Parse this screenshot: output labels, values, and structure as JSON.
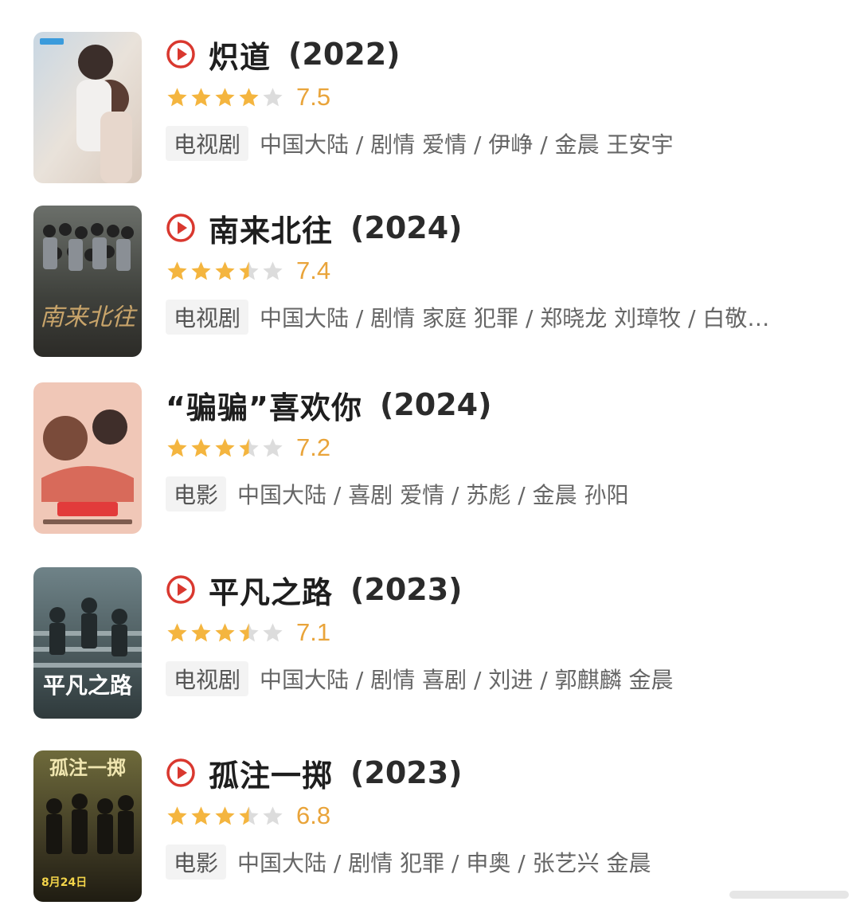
{
  "colors": {
    "play_icon": "#d9382f",
    "star_filled": "#f4b53f",
    "star_empty": "#dcdcdc",
    "score": "#e9a43a"
  },
  "items": [
    {
      "title": "炽道",
      "year": "(2022)",
      "has_play_icon": true,
      "stars": 4,
      "score": "7.5",
      "type": "电视剧",
      "meta": "中国大陆 / 剧情 爱情 / 伊峥 / 金晨 王安宇",
      "poster_icon": "poster-image"
    },
    {
      "title": "南来北往",
      "year": "(2024)",
      "has_play_icon": true,
      "stars": 3.5,
      "score": "7.4",
      "type": "电视剧",
      "meta": "中国大陆 / 剧情 家庭 犯罪 / 郑晓龙 刘璋牧 / 白敬…",
      "poster_icon": "poster-image"
    },
    {
      "title": "“骗骗”喜欢你",
      "year": "(2024)",
      "has_play_icon": false,
      "stars": 3.5,
      "score": "7.2",
      "type": "电影",
      "meta": "中国大陆 / 喜剧 爱情 / 苏彪 / 金晨 孙阳",
      "poster_icon": "poster-image"
    },
    {
      "title": "平凡之路",
      "year": "(2023)",
      "has_play_icon": true,
      "stars": 3.5,
      "score": "7.1",
      "type": "电视剧",
      "meta": "中国大陆 / 剧情 喜剧 / 刘进 / 郭麒麟 金晨",
      "poster_icon": "poster-image"
    },
    {
      "title": "孤注一掷",
      "year": "(2023)",
      "has_play_icon": true,
      "stars": 3.5,
      "score": "6.8",
      "type": "电影",
      "meta": "中国大陆 / 剧情 犯罪 / 申奥 / 张艺兴 金晨",
      "poster_icon": "poster-image"
    }
  ]
}
